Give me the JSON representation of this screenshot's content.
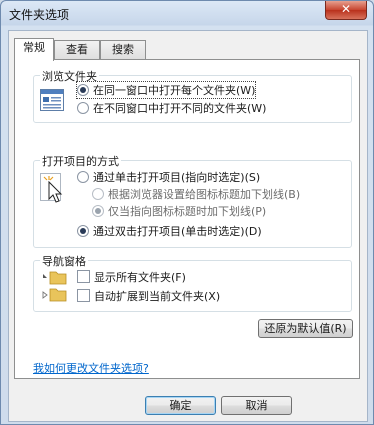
{
  "window": {
    "title": "文件夹选项",
    "close_label": "✕"
  },
  "tabs": [
    {
      "label": "常规",
      "active": true
    },
    {
      "label": "查看",
      "active": false
    },
    {
      "label": "搜索",
      "active": false
    }
  ],
  "browse_group": {
    "title": "浏览文件夹",
    "options": [
      {
        "label": "在同一窗口中打开每个文件夹(W)",
        "selected": true
      },
      {
        "label": "在不同窗口中打开不同的文件夹(W)",
        "selected": false
      }
    ]
  },
  "click_group": {
    "title": "打开项目的方式",
    "options": [
      {
        "label": "通过单击打开项目(指向时选定)(S)",
        "selected": false
      },
      {
        "label": "根据浏览器设置给图标标题加下划线(B)",
        "selected": false,
        "disabled": true
      },
      {
        "label": "仅当指向图标标题时加下划线(P)",
        "selected": true,
        "disabled": true
      },
      {
        "label": "通过双击打开项目(单击时选定)(D)",
        "selected": true
      }
    ]
  },
  "nav_group": {
    "title": "导航窗格",
    "options": [
      {
        "label": "显示所有文件夹(F)",
        "checked": false
      },
      {
        "label": "自动扩展到当前文件夹(X)",
        "checked": false
      }
    ]
  },
  "restore_button": "还原为默认值(R)",
  "help_link": "我如何更改文件夹选项?",
  "footer": {
    "ok": "确定",
    "cancel": "取消"
  },
  "colors": {
    "accent": "#3c7fb1",
    "link": "#0066cc",
    "close": "#c7442f"
  }
}
